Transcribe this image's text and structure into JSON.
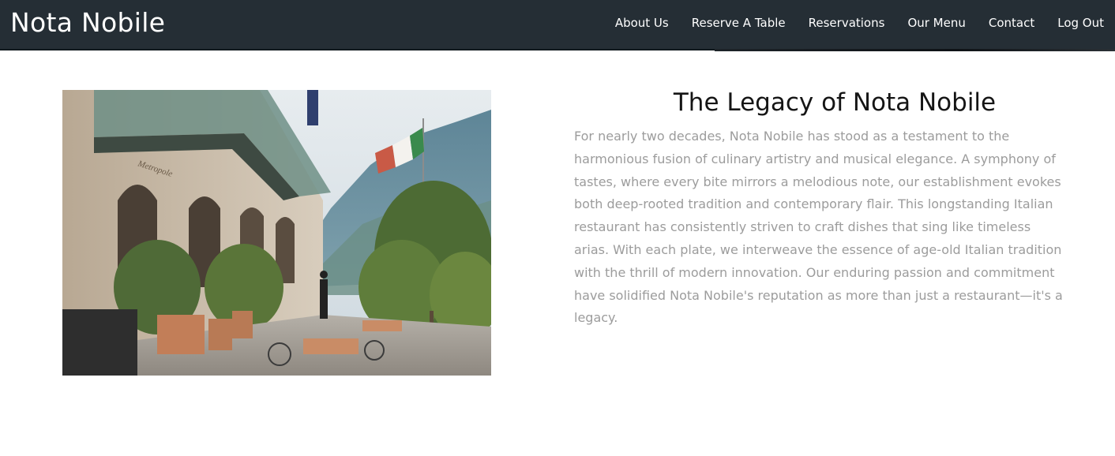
{
  "brand": {
    "name": "Nota Nobile"
  },
  "nav": {
    "items": [
      {
        "label": "About Us"
      },
      {
        "label": "Reserve A Table"
      },
      {
        "label": "Reservations"
      },
      {
        "label": "Our Menu"
      },
      {
        "label": "Contact"
      },
      {
        "label": "Log Out"
      }
    ]
  },
  "story": {
    "title": "The Legacy of Nota Nobile",
    "body": "For nearly two decades, Nota Nobile has stood as a testament to the harmonious fusion of culinary artistry and musical elegance. A symphony of tastes, where every bite mirrors a melodious note, our establishment evokes both deep-rooted tradition and contemporary flair. This longstanding Italian restaurant has consistently striven to craft dishes that sing like timeless arias. With each plate, we interweave the essence of age-old Italian tradition with the thrill of modern innovation. Our enduring passion and commitment have solidified Nota Nobile's reputation as more than just a restaurant—it's a legacy.",
    "photo_sign": "Metropole"
  },
  "colors": {
    "navbar_bg": "#252e35",
    "nav_text": "#ffffff",
    "title_text": "#151515",
    "body_text": "#9c9c9c"
  }
}
